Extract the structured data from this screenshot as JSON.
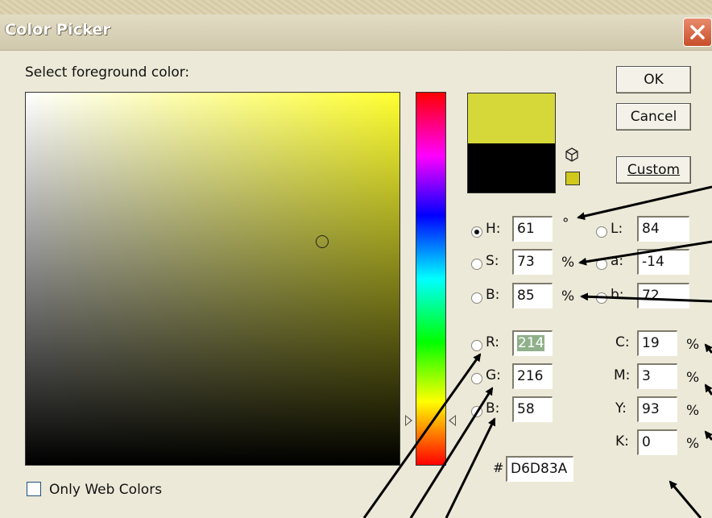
{
  "window": {
    "title": "Color Picker"
  },
  "prompt": "Select foreground color:",
  "buttons": {
    "ok": "OK",
    "cancel": "Cancel",
    "custom": "Custom"
  },
  "colors": {
    "new": "#d6d83a",
    "old": "#000000",
    "gamut_swatch": "#d0c81c"
  },
  "hsb": {
    "h": {
      "label": "H:",
      "value": "61",
      "unit": "°"
    },
    "s": {
      "label": "S:",
      "value": "73",
      "unit": "%"
    },
    "b": {
      "label": "B:",
      "value": "85",
      "unit": "%"
    }
  },
  "lab": {
    "l": {
      "label": "L:",
      "value": "84"
    },
    "a": {
      "label": "a:",
      "value": "-14"
    },
    "b": {
      "label": "b:",
      "value": "72"
    }
  },
  "rgb": {
    "r": {
      "label": "R:",
      "value": "214"
    },
    "g": {
      "label": "G:",
      "value": "216"
    },
    "b": {
      "label": "B:",
      "value": "58"
    }
  },
  "cmyk": {
    "c": {
      "label": "C:",
      "value": "19",
      "unit": "%"
    },
    "m": {
      "label": "M:",
      "value": "3",
      "unit": "%"
    },
    "y": {
      "label": "Y:",
      "value": "93",
      "unit": "%"
    },
    "k": {
      "label": "K:",
      "value": "0",
      "unit": "%"
    }
  },
  "hex": {
    "label": "#",
    "value": "D6D83A"
  },
  "web_colors_label": "Only Web Colors",
  "selected_mode": "H"
}
